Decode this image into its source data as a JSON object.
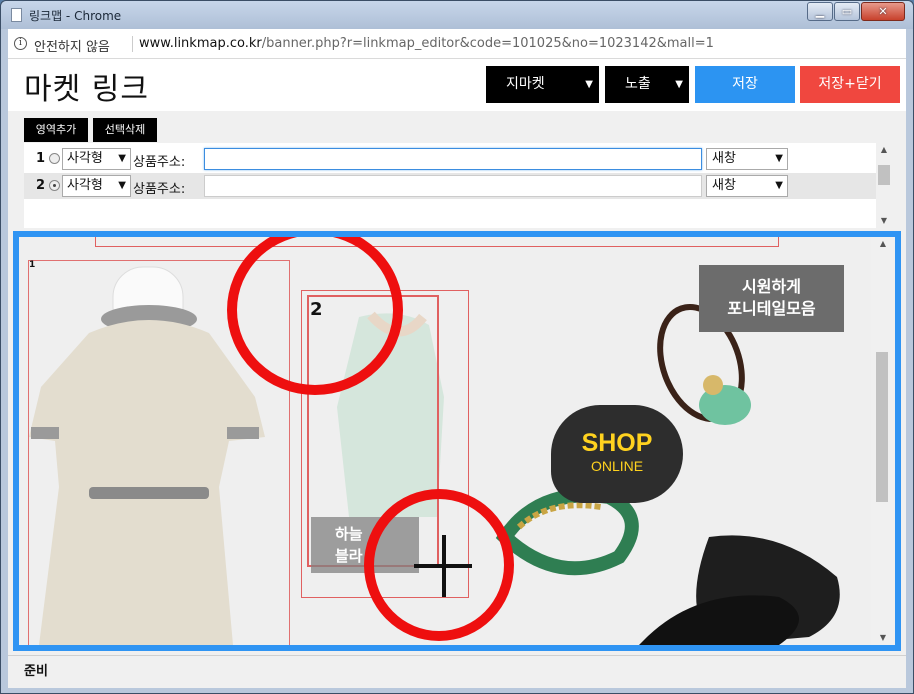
{
  "window": {
    "title": "링크맵 - Chrome"
  },
  "urlbar": {
    "security_label": "안전하지 않음",
    "url_domain": "www.linkmap.co.kr",
    "url_path": "/banner.php?r=linkmap_editor&code=101025&no=1023142&mall=1"
  },
  "header": {
    "title": "마켓 링크",
    "market_select": "지마켓",
    "expose_select": "노출",
    "save_label": "저장",
    "save_close_label": "저장+닫기"
  },
  "toolbar": {
    "add_area_label": "영역추가",
    "delete_selected_label": "선택삭제"
  },
  "areas": [
    {
      "number": "1",
      "shape": "사각형",
      "address_label": "상품주소:",
      "address_value": "",
      "target": "새창",
      "selected": false
    },
    {
      "number": "2",
      "shape": "사각형",
      "address_label": "상품주소:",
      "address_value": "",
      "target": "새창",
      "selected": true
    }
  ],
  "banner": {
    "area1_label": "1",
    "area2_label": "2",
    "badge_right_line1": "시원하게",
    "badge_right_line2": "포니테일모음",
    "badge_left_line1": "하늘",
    "badge_left_line2": "블라",
    "shop_big": "SHOP",
    "shop_small": "ONLINE"
  },
  "status": {
    "text": "준비"
  },
  "colors": {
    "accent_blue": "#2f94f3",
    "save_blue": "#2c94f2",
    "save_close_red": "#f0473f",
    "highlight_red": "#ee0f0f"
  }
}
